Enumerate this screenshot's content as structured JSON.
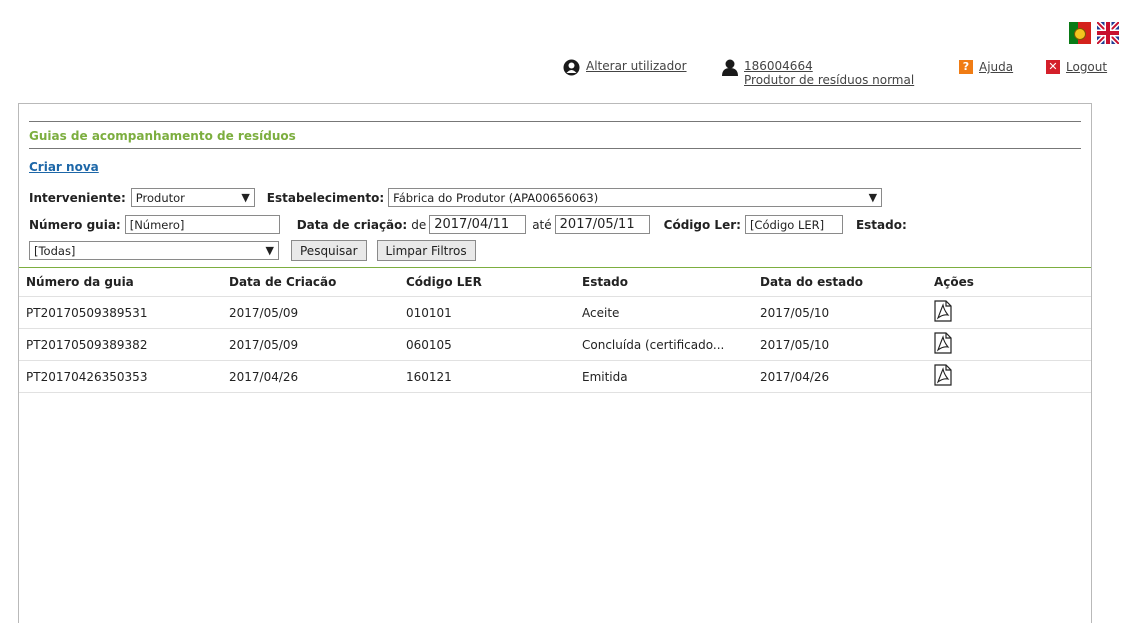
{
  "header": {
    "language_flags": [
      {
        "name": "Portuguese",
        "icon": "portugal-flag-icon"
      },
      {
        "name": "English",
        "icon": "uk-flag-icon"
      }
    ],
    "change_user_label": "Alterar utilizador",
    "user_id": "186004664",
    "user_role": "Produtor de resíduos normal",
    "help_label": "Ajuda",
    "logout_label": "Logout"
  },
  "main": {
    "section_title": "Guias de acompanhamento de resíduos",
    "create_link": "Criar nova",
    "filters": {
      "interveniente_label": "Interveniente:",
      "interveniente_value": "Produtor",
      "estabelecimento_label": "Estabelecimento:",
      "estabelecimento_value": "Fábrica do Produtor (APA00656063)",
      "numero_label": "Número guia:",
      "numero_placeholder": "[Número]",
      "data_label": "Data de criação:",
      "de_label": "de",
      "date_from": "2017/04/11",
      "ate_label": "até",
      "date_to": "2017/05/11",
      "codigo_label": "Código Ler:",
      "codigo_placeholder": "[Código LER]",
      "estado_label": "Estado:",
      "estado_value": "[Todas]",
      "search_button": "Pesquisar",
      "clear_button": "Limpar Filtros"
    },
    "table": {
      "columns": [
        "Número da guia",
        "Data de Criacão",
        "Código LER",
        "Estado",
        "Data do estado",
        "Ações"
      ],
      "rows": [
        {
          "numero": "PT20170509389531",
          "data_criacao": "2017/05/09",
          "codigo": "010101",
          "estado": "Aceite",
          "data_estado": "2017/05/10",
          "action_icon": "pdf-icon"
        },
        {
          "numero": "PT20170509389382",
          "data_criacao": "2017/05/09",
          "codigo": "060105",
          "estado": "Concluída (certificado...",
          "data_estado": "2017/05/10",
          "action_icon": "pdf-icon"
        },
        {
          "numero": "PT20170426350353",
          "data_criacao": "2017/04/26",
          "codigo": "160121",
          "estado": "Emitida",
          "data_estado": "2017/04/26",
          "action_icon": "pdf-icon"
        }
      ]
    }
  },
  "colors": {
    "accent_green": "#7cae3f",
    "link_blue": "#1d67a8",
    "help_orange": "#f07c14",
    "logout_red": "#d41f2a"
  }
}
